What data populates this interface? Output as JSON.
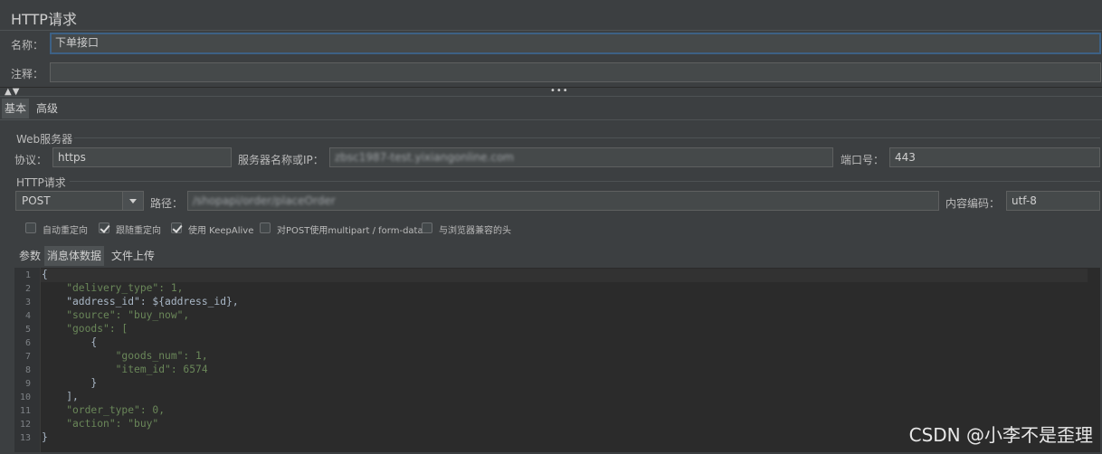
{
  "window": {
    "title": "HTTP请求"
  },
  "form": {
    "name_label": "名称：",
    "name_value": "下单接口",
    "comment_label": "注释：",
    "comment_value": ""
  },
  "splitter": {
    "grip": "•••",
    "arrows": "▲▼"
  },
  "top_tabs": [
    {
      "label": "基本"
    },
    {
      "label": "高级"
    }
  ],
  "web_server": {
    "section": "Web服务器",
    "protocol_label": "协议：",
    "protocol_value": "https",
    "server_label": "服务器名称或IP：",
    "server_value": "zbsc1987-test.yixiangonline.com",
    "port_label": "端口号：",
    "port_value": "443"
  },
  "http_request": {
    "section": "HTTP请求",
    "method": "POST",
    "path_label": "路径：",
    "path_value": "/shopapi/order/placeOrder",
    "encoding_label": "内容编码：",
    "encoding_value": "utf-8"
  },
  "options": [
    {
      "label": "自动重定向",
      "checked": false
    },
    {
      "label": "跟随重定向",
      "checked": true
    },
    {
      "label": "使用 KeepAlive",
      "checked": true
    },
    {
      "label": "对POST使用multipart / form-data",
      "checked": false
    },
    {
      "label": "与浏览器兼容的头",
      "checked": false
    }
  ],
  "body_tabs": [
    {
      "label": "参数"
    },
    {
      "label": "消息体数据"
    },
    {
      "label": "文件上传"
    }
  ],
  "editor": {
    "line_numbers": [
      "1",
      "2",
      "3",
      "4",
      "5",
      "6",
      "7",
      "8",
      "9",
      "10",
      "11",
      "12",
      "13"
    ],
    "lines": [
      "{",
      "    \"delivery_type\": 1,",
      "    \"address_id\": ${address_id},",
      "    \"source\": \"buy_now\",",
      "    \"goods\": [",
      "        {",
      "            \"goods_num\": 1,",
      "            \"item_id\": 6574",
      "        }",
      "    ],",
      "    \"order_type\": 0,",
      "    \"action\": \"buy\"",
      "}"
    ]
  },
  "watermark": "CSDN @小李不是歪理"
}
